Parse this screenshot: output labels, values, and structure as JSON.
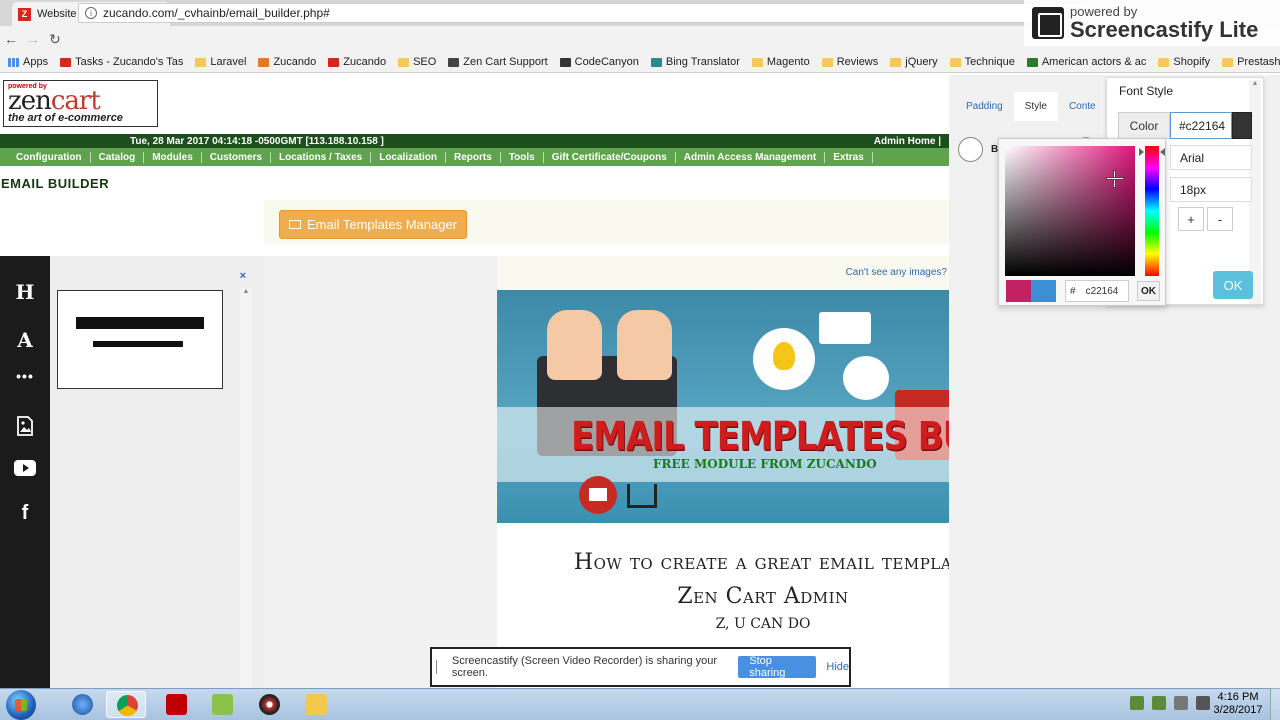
{
  "browser": {
    "tab_title": "Website Development | Z",
    "tab_favicon": "Z",
    "url": "zucando.com/_cvhainb/email_builder.php#",
    "bookmarks": [
      "Apps",
      "Tasks - Zucando's Tas",
      "Laravel",
      "Zucando",
      "Zucando",
      "SEO",
      "Zen Cart Support",
      "CodeCanyon",
      "Bing Translator",
      "Magento",
      "Reviews",
      "jQuery",
      "Technique",
      "American actors & ac",
      "Shopify",
      "Prestashop"
    ]
  },
  "screencastify": {
    "powered_by": "powered by",
    "brand": "Screencastify Lite",
    "share_message": "Screencastify (Screen Video Recorder) is sharing your screen.",
    "stop_label": "Stop sharing",
    "hide_label": "Hide"
  },
  "zencart": {
    "logo_powered": "powered by",
    "logo_name_a": "zen",
    "logo_name_b": "cart",
    "logo_tagline": "the art of e-commerce",
    "datetime": "Tue, 28 Mar 2017 04:14:18 -0500GMT [113.188.10.158 ]",
    "admin_home": "Admin Home |",
    "menu": [
      "Configuration",
      "Catalog",
      "Modules",
      "Customers",
      "Locations / Taxes",
      "Localization",
      "Reports",
      "Tools",
      "Gift Certificate/Coupons",
      "Admin Access Management",
      "Extras"
    ],
    "page_title": "EMAIL BUILDER",
    "templates_button": "Email Templates Manager"
  },
  "builder": {
    "tools": {
      "heading": "H",
      "text": "A",
      "divider": "•••",
      "facebook": "f"
    },
    "close_label": "×",
    "cant_see": "Can't see any images?",
    "hero_title": "EMAIL TEMPLATES BUILDER",
    "hero_subtitle": "FREE MODULE FROM ZUCANDO",
    "email_title_1": "How to create a great email templa",
    "email_title_2": "Zen Cart Admin",
    "email_subtitle": "Z, U CAN DO"
  },
  "settings": {
    "tabs": [
      "Padding",
      "Style",
      "Conte"
    ],
    "active_tab": "Style",
    "bold_label": "B",
    "panel_title": "Font Style",
    "color_label": "Color",
    "color_value": "#c22164",
    "font_value": "Arial",
    "size_value": "18px",
    "plus": "+",
    "minus": "-",
    "ok_label": "OK"
  },
  "colorpicker": {
    "hash": "#",
    "hex": "c22164",
    "ok_label": "OK",
    "new_color": "#c22164",
    "old_color": "#3a8fd6"
  },
  "taskbar": {
    "time": "4:16 PM",
    "date": "3/28/2017"
  }
}
